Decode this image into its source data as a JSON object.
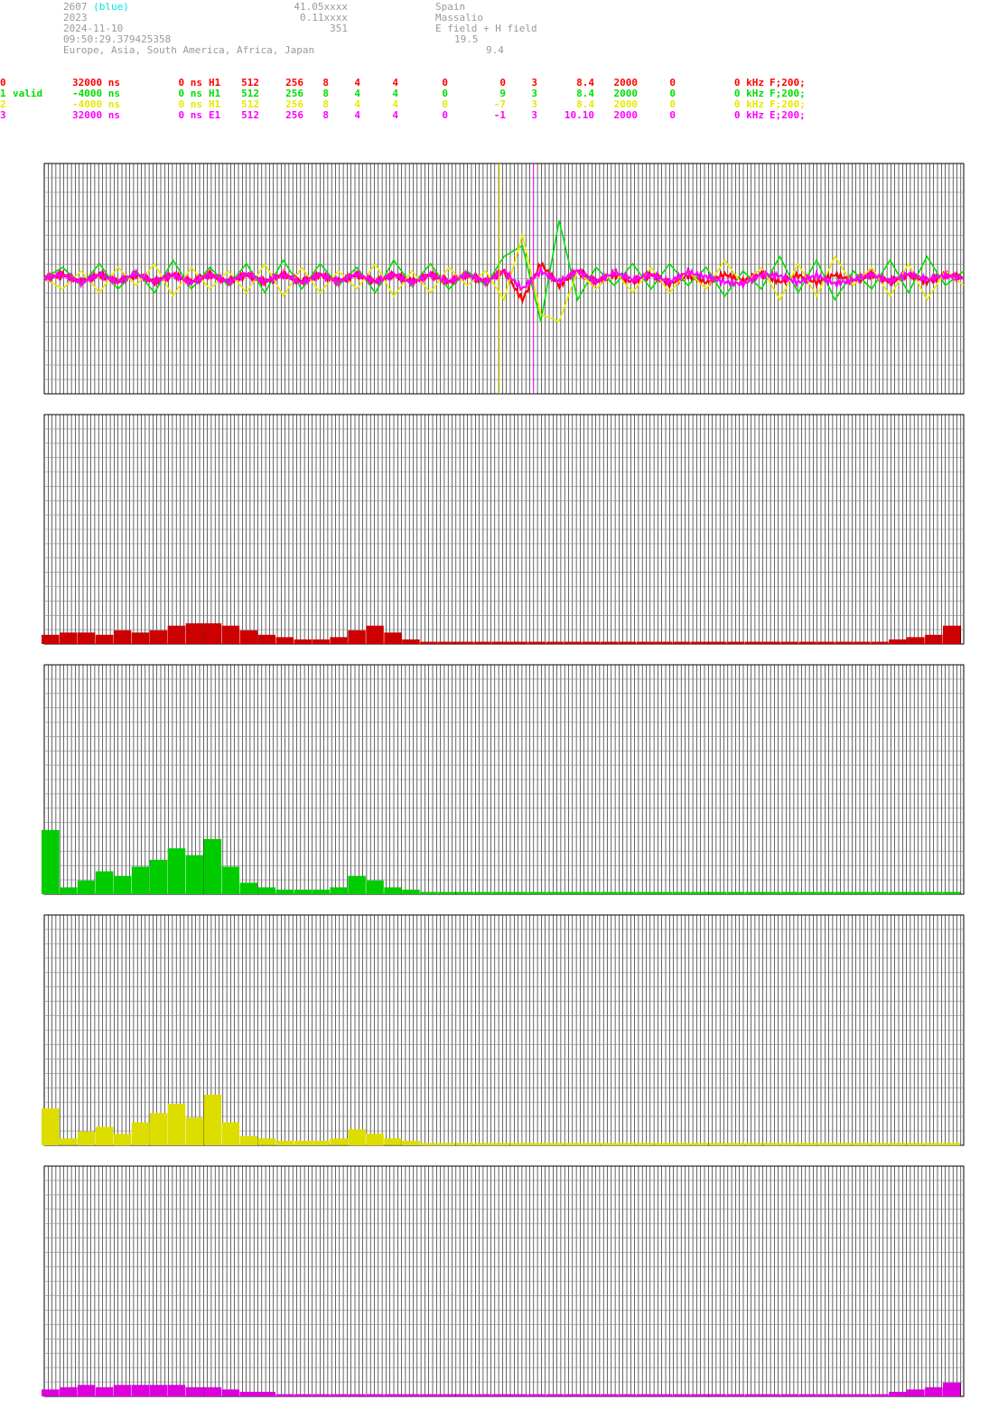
{
  "header": {
    "col1": {
      "line1_id": "2607",
      "line1_tag": "(blue)",
      "line2": "2023",
      "line3": "2024-11-10",
      "line4": "09:50:29.379425358",
      "line5": "Europe, Asia, South America, Africa, Japan"
    },
    "col2": {
      "line1": "41.05xxxx",
      "line2": "0.11xxxx",
      "line3": "351"
    },
    "col3": {
      "line1": "Spain",
      "line2": "Massalio",
      "line3": "E field + H field",
      "line4": "19.5",
      "line5": "9.4"
    }
  },
  "channels": [
    {
      "id": "0",
      "status": "",
      "delay": "32000 ns",
      "offset": "0 ns",
      "sensor": "H1",
      "n1": "512",
      "n2": "256",
      "n3": "8",
      "n4": "4",
      "n5": "4",
      "n6": "0",
      "val": "0",
      "v3": "3",
      "gain": "8.4",
      "rate": "2000",
      "z": "0",
      "freq": "0 kHz",
      "filter": "F;200;",
      "color": "#ff0000"
    },
    {
      "id": "1",
      "status": "valid",
      "delay": "-4000 ns",
      "offset": "0 ns",
      "sensor": "H1",
      "n1": "512",
      "n2": "256",
      "n3": "8",
      "n4": "4",
      "n5": "4",
      "n6": "0",
      "val": "9",
      "v3": "3",
      "gain": "8.4",
      "rate": "2000",
      "z": "0",
      "freq": "0 kHz",
      "filter": "F;200;",
      "color": "#00dd00"
    },
    {
      "id": "2",
      "status": "",
      "delay": "-4000 ns",
      "offset": "0 ns",
      "sensor": "H1",
      "n1": "512",
      "n2": "256",
      "n3": "8",
      "n4": "4",
      "n5": "4",
      "n6": "0",
      "val": "-7",
      "v3": "3",
      "gain": "8.4",
      "rate": "2000",
      "z": "0",
      "freq": "0 kHz",
      "filter": "F;200;",
      "color": "#e8e800"
    },
    {
      "id": "3",
      "status": "",
      "delay": "32000 ns",
      "offset": "0 ns",
      "sensor": "E1",
      "n1": "512",
      "n2": "256",
      "n3": "8",
      "n4": "4",
      "n5": "4",
      "n6": "0",
      "val": "-1",
      "v3": "3",
      "gain": "10.10",
      "rate": "2000",
      "z": "0",
      "freq": "0 kHz",
      "filter": "E;200;",
      "color": "#ff00ff"
    }
  ],
  "chart_data": [
    {
      "type": "line",
      "title": "",
      "x": [
        0,
        0.02,
        0.04,
        0.06,
        0.08,
        0.1,
        0.12,
        0.14,
        0.16,
        0.18,
        0.2,
        0.22,
        0.24,
        0.26,
        0.28,
        0.3,
        0.32,
        0.34,
        0.36,
        0.38,
        0.4,
        0.42,
        0.44,
        0.46,
        0.48,
        0.5,
        0.52,
        0.54,
        0.56,
        0.58,
        0.6,
        0.62,
        0.64,
        0.66,
        0.68,
        0.7,
        0.72,
        0.74,
        0.76,
        0.78,
        0.8,
        0.82,
        0.84,
        0.86,
        0.88,
        0.9,
        0.92,
        0.94,
        0.96,
        0.98,
        1.0
      ],
      "series": [
        {
          "values": [
            0,
            0.05,
            -0.05,
            0.05,
            -0.05,
            0.05,
            -0.05,
            0.05,
            -0.05,
            0.05,
            -0.05,
            0.05,
            -0.05,
            0.05,
            -0.05,
            0.05,
            -0.05,
            0.05,
            -0.05,
            0.05,
            -0.05,
            0.05,
            -0.05,
            0.05,
            -0.05,
            0.1,
            -0.3,
            0.2,
            -0.1,
            0.1,
            -0.05,
            0.05,
            -0.05,
            0.05,
            -0.08,
            0.04,
            -0.06,
            0.05,
            -0.04,
            0.06,
            -0.05,
            0.04,
            -0.06,
            0.05,
            -0.04,
            0.05,
            -0.05,
            0.05,
            -0.05,
            0.05,
            0
          ]
        },
        {
          "values": [
            0,
            0.15,
            -0.1,
            0.2,
            -0.15,
            0.1,
            -0.2,
            0.25,
            -0.15,
            0.15,
            -0.1,
            0.2,
            -0.2,
            0.25,
            -0.15,
            0.2,
            -0.1,
            0.15,
            -0.2,
            0.25,
            -0.1,
            0.2,
            -0.15,
            0.1,
            -0.1,
            0.3,
            0.45,
            -0.6,
            0.8,
            -0.3,
            0.15,
            -0.1,
            0.2,
            -0.15,
            0.2,
            -0.1,
            0.15,
            -0.25,
            0.1,
            -0.15,
            0.3,
            -0.2,
            0.25,
            -0.3,
            0.1,
            -0.15,
            0.25,
            -0.2,
            0.3,
            -0.1,
            0.1
          ]
        },
        {
          "values": [
            0,
            -0.15,
            0.1,
            -0.2,
            0.15,
            -0.1,
            0.2,
            -0.25,
            0.15,
            -0.15,
            0.1,
            -0.2,
            0.2,
            -0.25,
            0.15,
            -0.2,
            0.1,
            -0.15,
            0.2,
            -0.25,
            0.1,
            -0.2,
            0.15,
            -0.1,
            0.1,
            -0.3,
            0.6,
            -0.5,
            -0.6,
            0.1,
            -0.15,
            0.1,
            -0.2,
            0.15,
            -0.2,
            0.1,
            -0.15,
            0.25,
            -0.1,
            0.15,
            -0.3,
            0.2,
            -0.25,
            0.3,
            -0.1,
            0.15,
            -0.25,
            0.2,
            -0.3,
            0.1,
            -0.1
          ]
        },
        {
          "values": [
            0,
            0.05,
            -0.06,
            0.05,
            -0.05,
            0.06,
            -0.05,
            0.05,
            -0.06,
            0.05,
            -0.05,
            0.06,
            -0.05,
            0.05,
            -0.06,
            0.05,
            -0.05,
            0.06,
            -0.05,
            0.05,
            -0.06,
            0.05,
            -0.05,
            0.05,
            -0.05,
            0.1,
            -0.15,
            0.1,
            -0.05,
            0.1,
            -0.05,
            0.08,
            -0.02,
            0.05,
            -0.05,
            0.08,
            0.02,
            -0.05,
            -0.08,
            0.05,
            0.03,
            -0.06,
            0.04,
            -0.08,
            -0.02,
            0.05,
            -0.04,
            0.06,
            -0.02,
            0.04,
            0
          ]
        }
      ]
    },
    {
      "type": "bar",
      "title": "",
      "values": [
        0.04,
        0.05,
        0.05,
        0.04,
        0.06,
        0.05,
        0.06,
        0.08,
        0.09,
        0.09,
        0.08,
        0.06,
        0.04,
        0.03,
        0.02,
        0.02,
        0.03,
        0.06,
        0.08,
        0.05,
        0.02,
        0.01,
        0.01,
        0.01,
        0.01,
        0.01,
        0.01,
        0.01,
        0.01,
        0.01,
        0.01,
        0.01,
        0.01,
        0.01,
        0.01,
        0.01,
        0.01,
        0.01,
        0.01,
        0.01,
        0.01,
        0.01,
        0.01,
        0.01,
        0.01,
        0.01,
        0.01,
        0.02,
        0.03,
        0.04,
        0.08
      ],
      "ylim": [
        0,
        1
      ]
    },
    {
      "type": "bar",
      "title": "",
      "values": [
        0.28,
        0.03,
        0.06,
        0.1,
        0.08,
        0.12,
        0.15,
        0.2,
        0.17,
        0.24,
        0.12,
        0.05,
        0.03,
        0.02,
        0.02,
        0.02,
        0.03,
        0.08,
        0.06,
        0.03,
        0.02,
        0.01,
        0.01,
        0.01,
        0.01,
        0.01,
        0.01,
        0.01,
        0.01,
        0.01,
        0.01,
        0.01,
        0.01,
        0.01,
        0.01,
        0.01,
        0.01,
        0.01,
        0.01,
        0.01,
        0.01,
        0.01,
        0.01,
        0.01,
        0.01,
        0.01,
        0.01,
        0.01,
        0.01,
        0.01,
        0.01
      ],
      "ylim": [
        0,
        1
      ]
    },
    {
      "type": "bar",
      "title": "",
      "values": [
        0.16,
        0.03,
        0.06,
        0.08,
        0.05,
        0.1,
        0.14,
        0.18,
        0.12,
        0.22,
        0.1,
        0.04,
        0.03,
        0.02,
        0.02,
        0.02,
        0.03,
        0.07,
        0.05,
        0.03,
        0.02,
        0.01,
        0.01,
        0.01,
        0.01,
        0.01,
        0.01,
        0.01,
        0.01,
        0.01,
        0.01,
        0.01,
        0.01,
        0.01,
        0.01,
        0.01,
        0.01,
        0.01,
        0.01,
        0.01,
        0.01,
        0.01,
        0.01,
        0.01,
        0.01,
        0.01,
        0.01,
        0.01,
        0.01,
        0.01,
        0.01
      ],
      "ylim": [
        0,
        1
      ]
    },
    {
      "type": "bar",
      "title": "",
      "values": [
        0.03,
        0.04,
        0.05,
        0.04,
        0.05,
        0.05,
        0.05,
        0.05,
        0.04,
        0.04,
        0.03,
        0.02,
        0.02,
        0.01,
        0.01,
        0.01,
        0.01,
        0.01,
        0.01,
        0.01,
        0.01,
        0.01,
        0.01,
        0.01,
        0.01,
        0.01,
        0.01,
        0.01,
        0.01,
        0.01,
        0.01,
        0.01,
        0.01,
        0.01,
        0.01,
        0.01,
        0.01,
        0.01,
        0.01,
        0.01,
        0.01,
        0.01,
        0.01,
        0.01,
        0.01,
        0.01,
        0.01,
        0.02,
        0.03,
        0.04,
        0.06
      ],
      "ylim": [
        0,
        1
      ]
    }
  ],
  "markers": [
    {
      "x": 0.495,
      "color": "#ffff00"
    },
    {
      "x": 0.532,
      "color": "#ff00ff"
    }
  ]
}
